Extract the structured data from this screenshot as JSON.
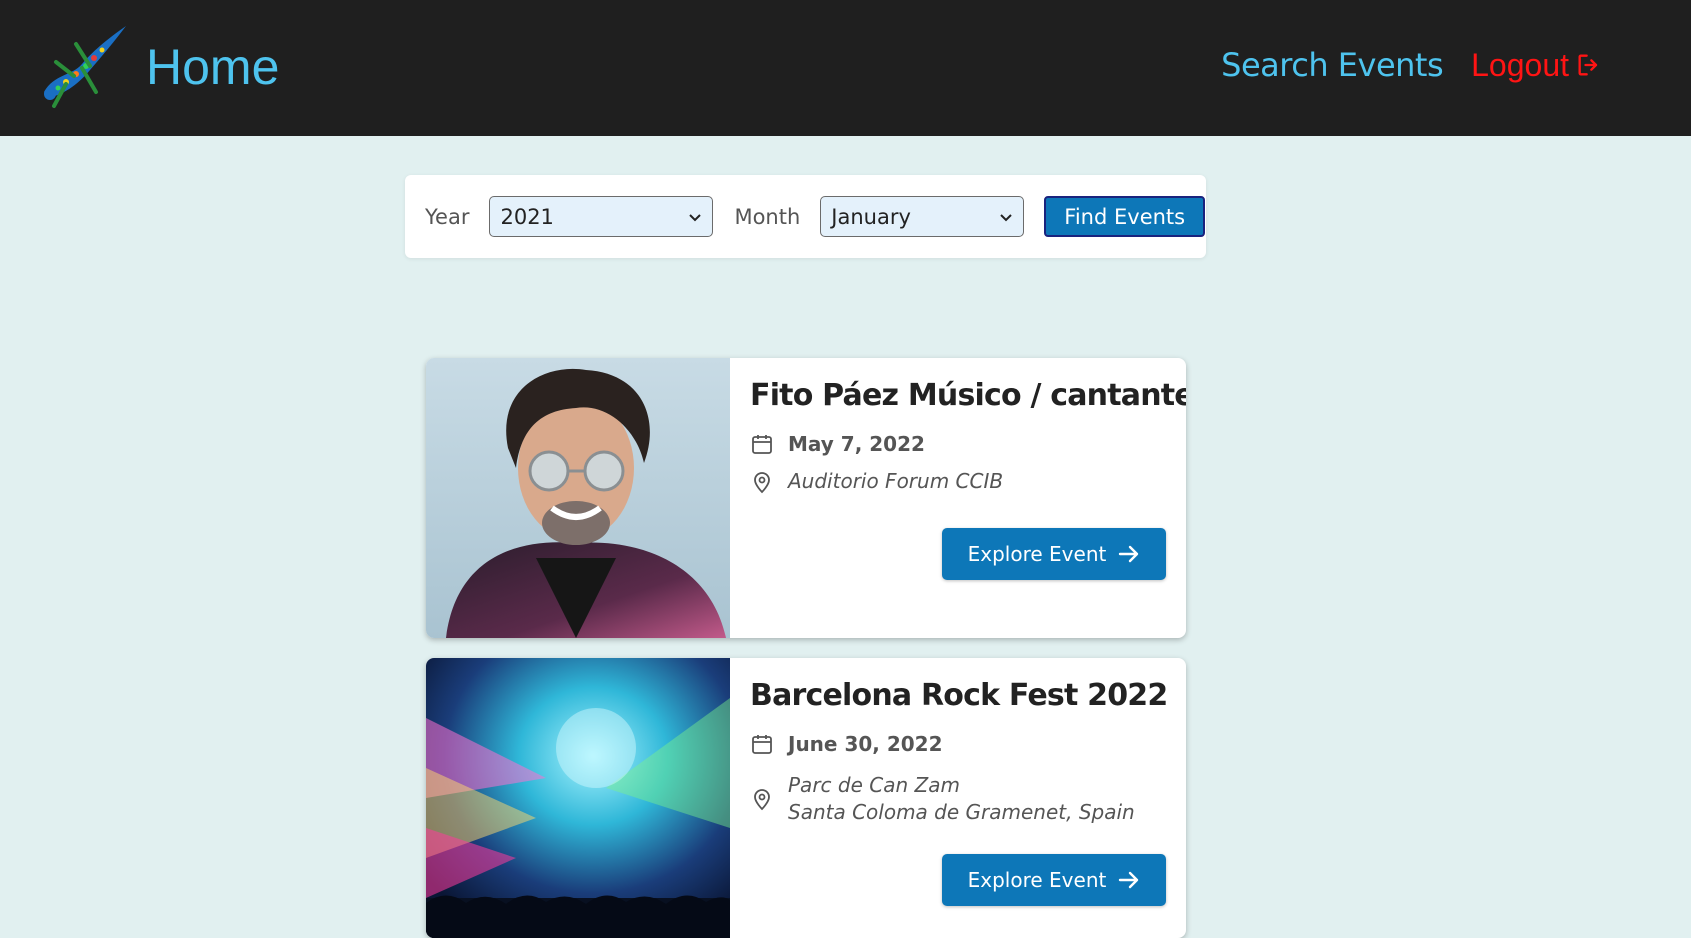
{
  "header": {
    "title": "Home",
    "nav_search": "Search Events",
    "nav_logout": "Logout"
  },
  "filter": {
    "year_label": "Year",
    "year_value": "2021",
    "month_label": "Month",
    "month_value": "January",
    "find_label": "Find Events"
  },
  "events": [
    {
      "title": "Fito Páez Músico / cantante",
      "date": "May 7, 2022",
      "location_line1": "Auditorio Forum CCIB",
      "location_line2": "",
      "button": "Explore Event"
    },
    {
      "title": "Barcelona Rock Fest 2022",
      "date": "June 30, 2022",
      "location_line1": "Parc de Can Zam",
      "location_line2": "Santa Coloma de Gramenet, Spain",
      "button": "Explore Event"
    }
  ],
  "colors": {
    "accent": "#4ec3ee",
    "logout": "#ff1414",
    "primary_button": "#0d77b8",
    "background": "#e1f0f0",
    "navbar": "#1f1f1f"
  }
}
